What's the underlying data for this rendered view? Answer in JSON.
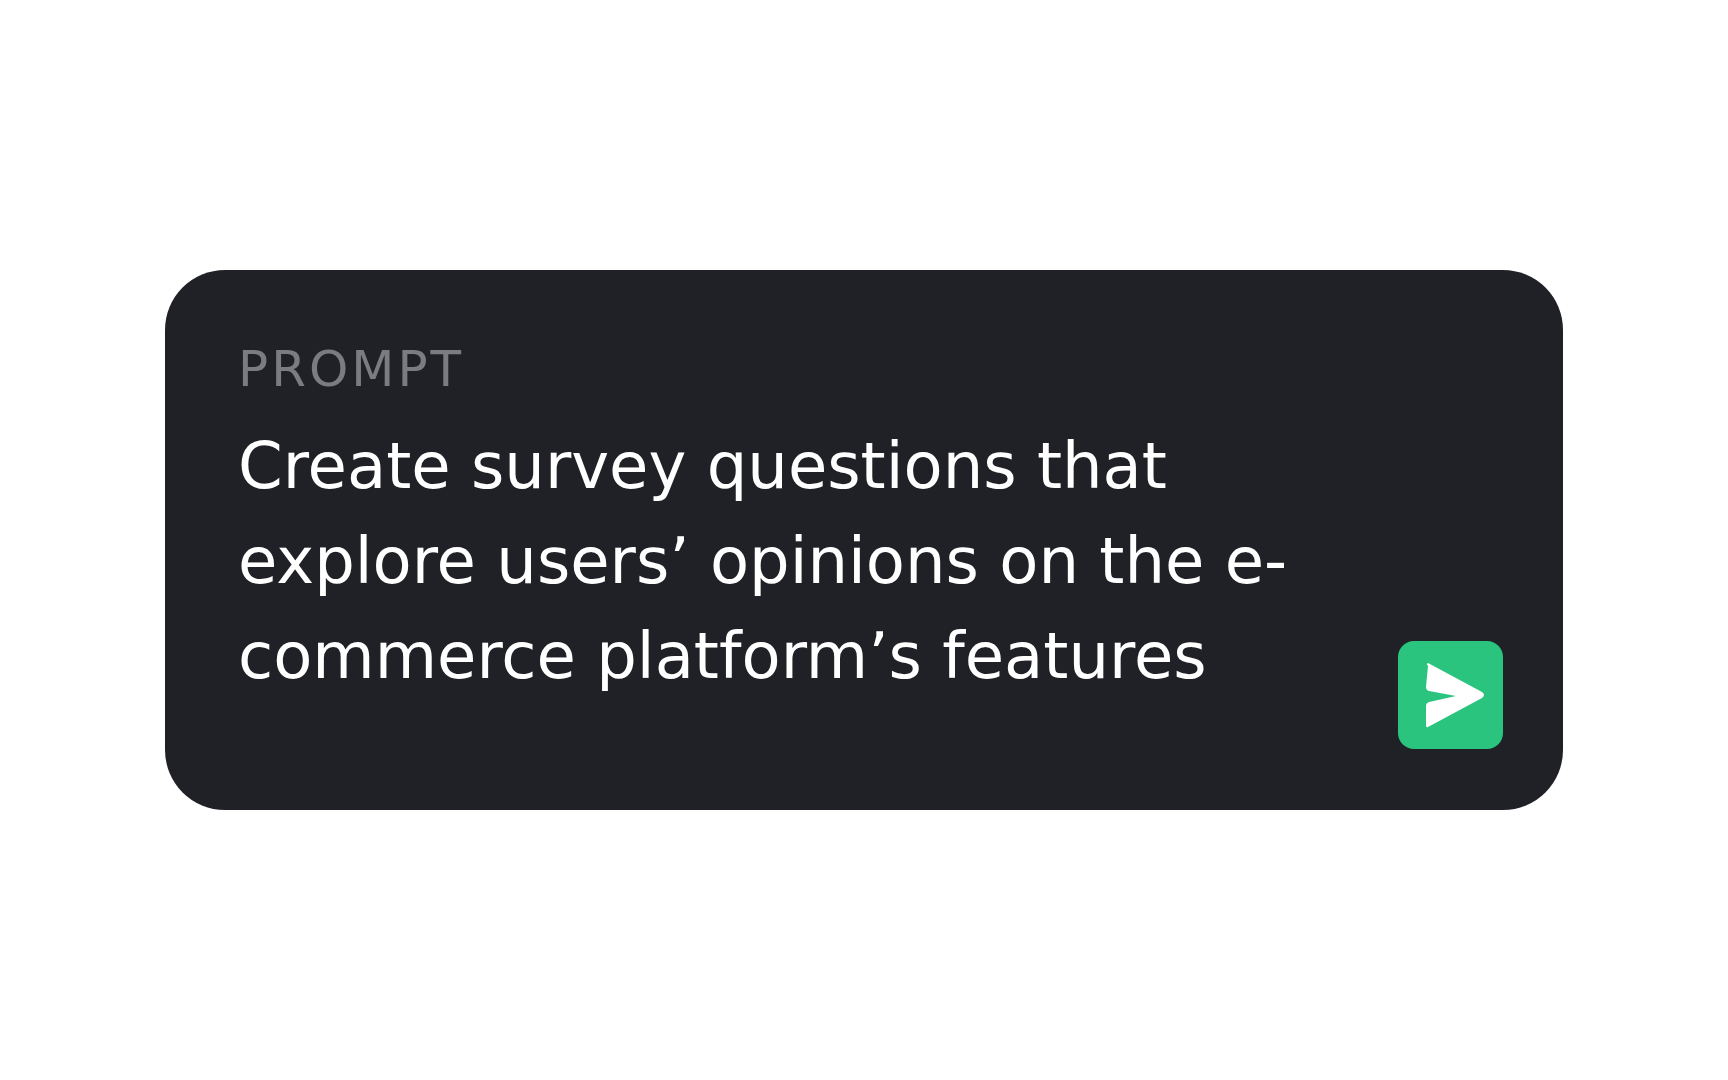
{
  "card": {
    "label": "PROMPT",
    "prompt": "Create survey questions that explore users’ opinions on the e-commerce platform’s features"
  }
}
